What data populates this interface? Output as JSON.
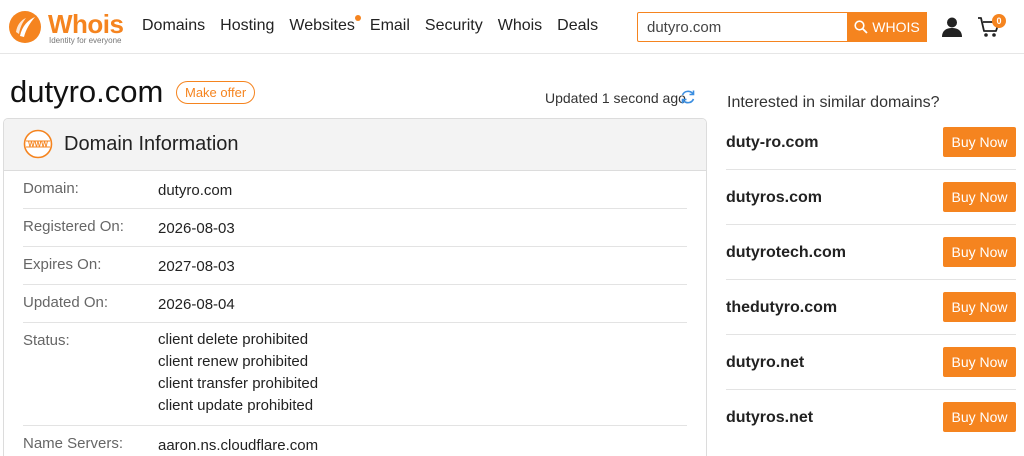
{
  "brand": {
    "name": "Whois",
    "tagline": "Identity for everyone",
    "accent_color": "#f5841f"
  },
  "nav": {
    "items": [
      "Domains",
      "Hosting",
      "Websites",
      "Email",
      "Security",
      "Whois",
      "Deals"
    ]
  },
  "search": {
    "value": "dutyro.com",
    "button_label": "WHOIS",
    "button_icon": "search-icon"
  },
  "cart": {
    "count": "0"
  },
  "page": {
    "title": "dutyro.com",
    "offer_label": "Make offer",
    "updated_text": "Updated 1 second ago"
  },
  "domain_info": {
    "heading": "Domain Information",
    "rows": [
      {
        "label": "Domain:",
        "value": "dutyro.com"
      },
      {
        "label": "Registered On:",
        "value": "2026-08-03"
      },
      {
        "label": "Expires On:",
        "value": "2027-08-03"
      },
      {
        "label": "Updated On:",
        "value": "2026-08-04"
      },
      {
        "label": "Status:",
        "value": [
          "client delete prohibited",
          "client renew prohibited",
          "client transfer prohibited",
          "client update prohibited"
        ]
      },
      {
        "label": "Name Servers:",
        "value": "aaron.ns.cloudflare.com"
      }
    ]
  },
  "similar": {
    "heading": "Interested in similar domains?",
    "buy_label": "Buy Now",
    "domains": [
      "duty-ro.com",
      "dutyros.com",
      "dutyrotech.com",
      "thedutyro.com",
      "dutyro.net",
      "dutyros.net"
    ]
  }
}
